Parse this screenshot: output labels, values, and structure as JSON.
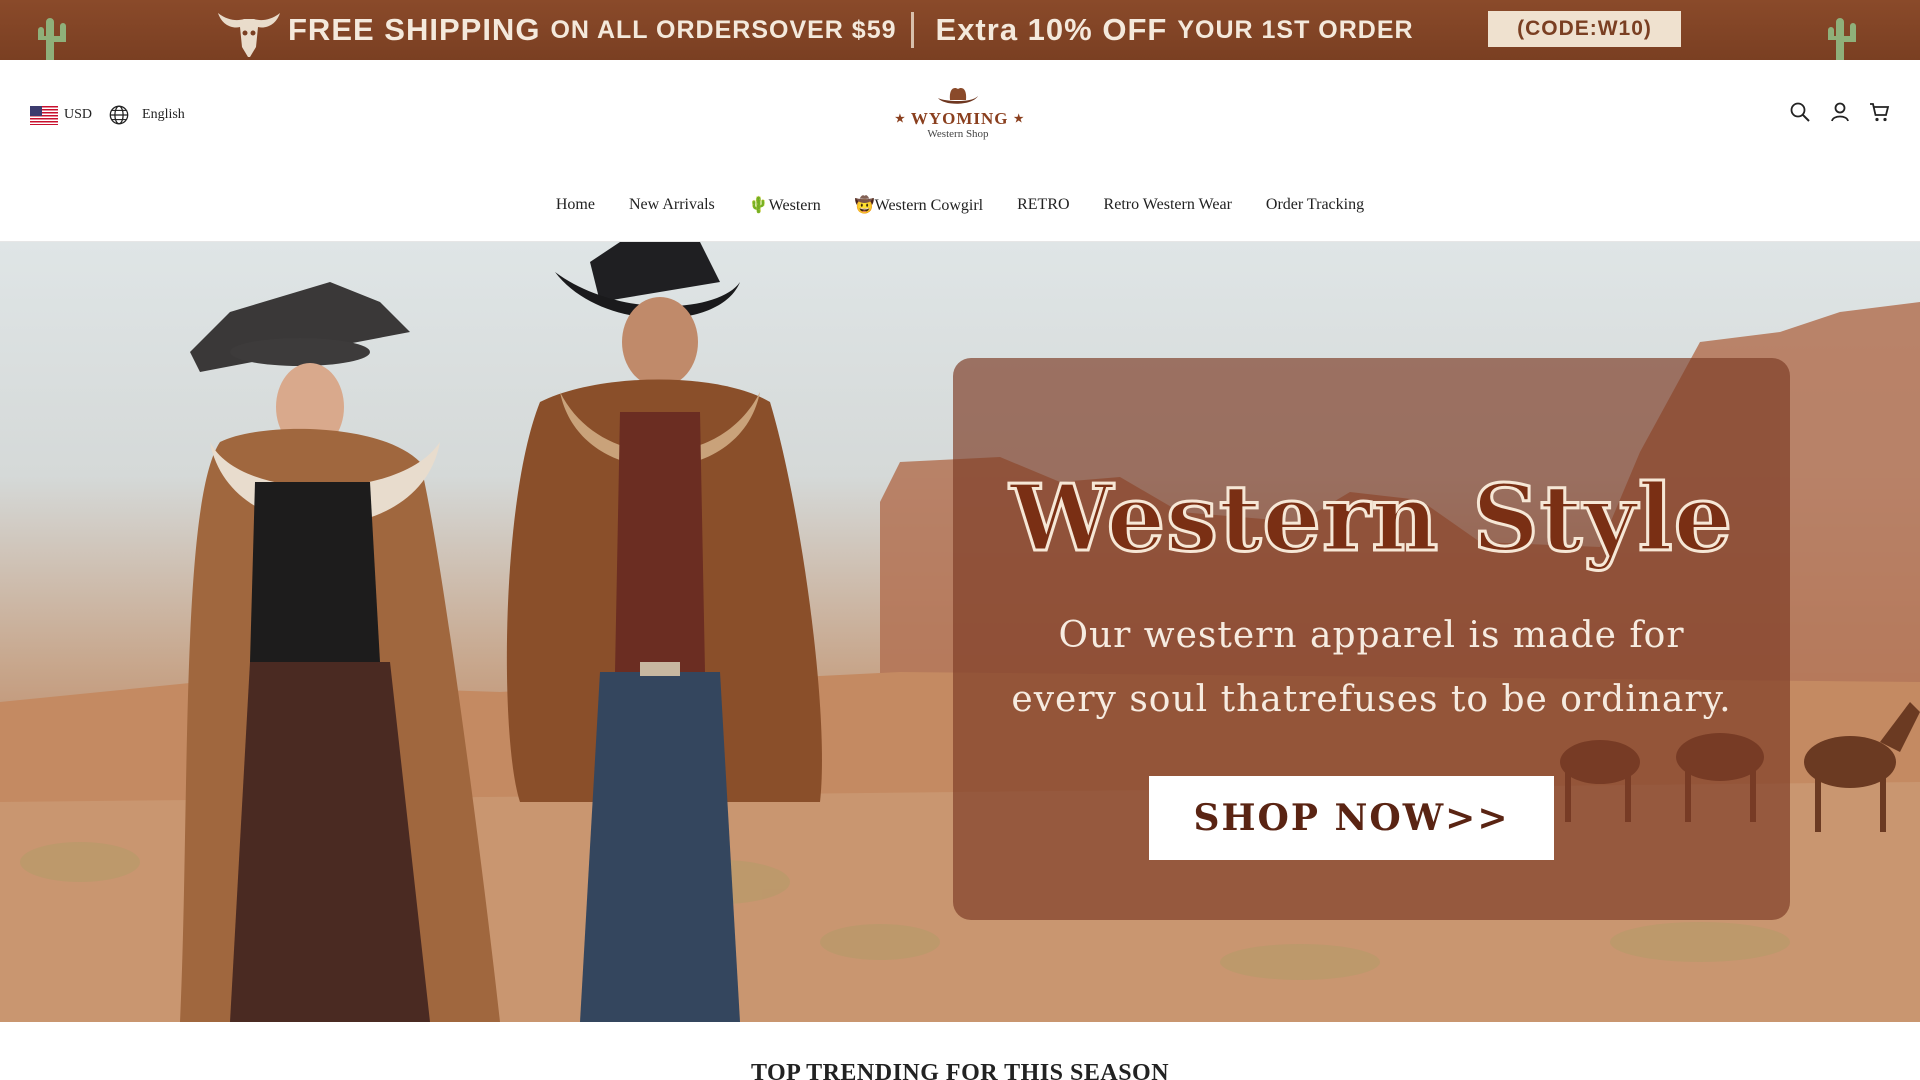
{
  "announcement": {
    "part1_big": "FREE SHIPPING",
    "part1_small": "ON ALL ORDERSOVER $59",
    "part2_big": "Extra 10% OFF",
    "part2_small": "YOUR 1ST ORDER",
    "code": "(CODE:W10)",
    "icons": [
      "cactus-icon",
      "skull-icon"
    ]
  },
  "header": {
    "currency": "USD",
    "language": "English",
    "logo": {
      "brand": "WYOMING",
      "subtitle": "Western Shop"
    },
    "icons": [
      "search-icon",
      "account-icon",
      "cart-icon"
    ]
  },
  "nav": {
    "items": [
      "Home",
      "New Arrivals",
      "🌵Western",
      "🤠Western Cowgirl",
      "RETRO",
      "Retro Western Wear",
      "Order Tracking"
    ]
  },
  "hero": {
    "title": "Western Style",
    "subtitle_line1": "Our western apparel is made for",
    "subtitle_line2": "every soul thatrefuses to be ordinary.",
    "cta": "SHOP NOW>>"
  },
  "section": {
    "heading": "TOP TRENDING FOR THIS SEASON"
  },
  "colors": {
    "announcement_bg": "#7a3f22",
    "brand": "#8a3f1e",
    "overlay": "#7d3c26"
  }
}
